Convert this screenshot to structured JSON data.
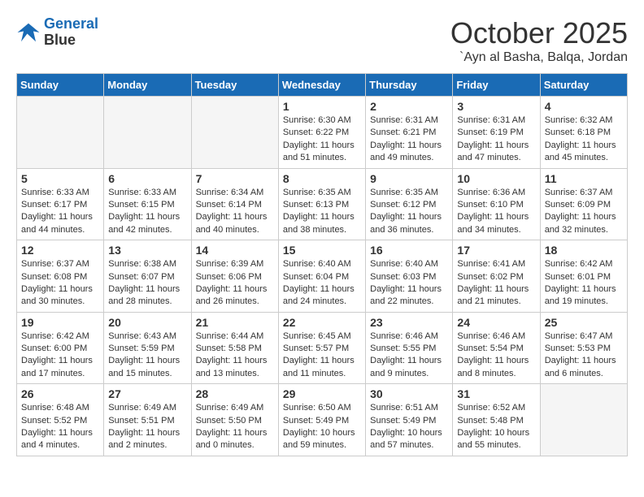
{
  "header": {
    "logo_line1": "General",
    "logo_line2": "Blue",
    "month": "October 2025",
    "location": "`Ayn al Basha, Balqa, Jordan"
  },
  "weekdays": [
    "Sunday",
    "Monday",
    "Tuesday",
    "Wednesday",
    "Thursday",
    "Friday",
    "Saturday"
  ],
  "weeks": [
    [
      {
        "day": "",
        "info": ""
      },
      {
        "day": "",
        "info": ""
      },
      {
        "day": "",
        "info": ""
      },
      {
        "day": "1",
        "info": "Sunrise: 6:30 AM\nSunset: 6:22 PM\nDaylight: 11 hours\nand 51 minutes."
      },
      {
        "day": "2",
        "info": "Sunrise: 6:31 AM\nSunset: 6:21 PM\nDaylight: 11 hours\nand 49 minutes."
      },
      {
        "day": "3",
        "info": "Sunrise: 6:31 AM\nSunset: 6:19 PM\nDaylight: 11 hours\nand 47 minutes."
      },
      {
        "day": "4",
        "info": "Sunrise: 6:32 AM\nSunset: 6:18 PM\nDaylight: 11 hours\nand 45 minutes."
      }
    ],
    [
      {
        "day": "5",
        "info": "Sunrise: 6:33 AM\nSunset: 6:17 PM\nDaylight: 11 hours\nand 44 minutes."
      },
      {
        "day": "6",
        "info": "Sunrise: 6:33 AM\nSunset: 6:15 PM\nDaylight: 11 hours\nand 42 minutes."
      },
      {
        "day": "7",
        "info": "Sunrise: 6:34 AM\nSunset: 6:14 PM\nDaylight: 11 hours\nand 40 minutes."
      },
      {
        "day": "8",
        "info": "Sunrise: 6:35 AM\nSunset: 6:13 PM\nDaylight: 11 hours\nand 38 minutes."
      },
      {
        "day": "9",
        "info": "Sunrise: 6:35 AM\nSunset: 6:12 PM\nDaylight: 11 hours\nand 36 minutes."
      },
      {
        "day": "10",
        "info": "Sunrise: 6:36 AM\nSunset: 6:10 PM\nDaylight: 11 hours\nand 34 minutes."
      },
      {
        "day": "11",
        "info": "Sunrise: 6:37 AM\nSunset: 6:09 PM\nDaylight: 11 hours\nand 32 minutes."
      }
    ],
    [
      {
        "day": "12",
        "info": "Sunrise: 6:37 AM\nSunset: 6:08 PM\nDaylight: 11 hours\nand 30 minutes."
      },
      {
        "day": "13",
        "info": "Sunrise: 6:38 AM\nSunset: 6:07 PM\nDaylight: 11 hours\nand 28 minutes."
      },
      {
        "day": "14",
        "info": "Sunrise: 6:39 AM\nSunset: 6:06 PM\nDaylight: 11 hours\nand 26 minutes."
      },
      {
        "day": "15",
        "info": "Sunrise: 6:40 AM\nSunset: 6:04 PM\nDaylight: 11 hours\nand 24 minutes."
      },
      {
        "day": "16",
        "info": "Sunrise: 6:40 AM\nSunset: 6:03 PM\nDaylight: 11 hours\nand 22 minutes."
      },
      {
        "day": "17",
        "info": "Sunrise: 6:41 AM\nSunset: 6:02 PM\nDaylight: 11 hours\nand 21 minutes."
      },
      {
        "day": "18",
        "info": "Sunrise: 6:42 AM\nSunset: 6:01 PM\nDaylight: 11 hours\nand 19 minutes."
      }
    ],
    [
      {
        "day": "19",
        "info": "Sunrise: 6:42 AM\nSunset: 6:00 PM\nDaylight: 11 hours\nand 17 minutes."
      },
      {
        "day": "20",
        "info": "Sunrise: 6:43 AM\nSunset: 5:59 PM\nDaylight: 11 hours\nand 15 minutes."
      },
      {
        "day": "21",
        "info": "Sunrise: 6:44 AM\nSunset: 5:58 PM\nDaylight: 11 hours\nand 13 minutes."
      },
      {
        "day": "22",
        "info": "Sunrise: 6:45 AM\nSunset: 5:57 PM\nDaylight: 11 hours\nand 11 minutes."
      },
      {
        "day": "23",
        "info": "Sunrise: 6:46 AM\nSunset: 5:55 PM\nDaylight: 11 hours\nand 9 minutes."
      },
      {
        "day": "24",
        "info": "Sunrise: 6:46 AM\nSunset: 5:54 PM\nDaylight: 11 hours\nand 8 minutes."
      },
      {
        "day": "25",
        "info": "Sunrise: 6:47 AM\nSunset: 5:53 PM\nDaylight: 11 hours\nand 6 minutes."
      }
    ],
    [
      {
        "day": "26",
        "info": "Sunrise: 6:48 AM\nSunset: 5:52 PM\nDaylight: 11 hours\nand 4 minutes."
      },
      {
        "day": "27",
        "info": "Sunrise: 6:49 AM\nSunset: 5:51 PM\nDaylight: 11 hours\nand 2 minutes."
      },
      {
        "day": "28",
        "info": "Sunrise: 6:49 AM\nSunset: 5:50 PM\nDaylight: 11 hours\nand 0 minutes."
      },
      {
        "day": "29",
        "info": "Sunrise: 6:50 AM\nSunset: 5:49 PM\nDaylight: 10 hours\nand 59 minutes."
      },
      {
        "day": "30",
        "info": "Sunrise: 6:51 AM\nSunset: 5:49 PM\nDaylight: 10 hours\nand 57 minutes."
      },
      {
        "day": "31",
        "info": "Sunrise: 6:52 AM\nSunset: 5:48 PM\nDaylight: 10 hours\nand 55 minutes."
      },
      {
        "day": "",
        "info": ""
      }
    ]
  ]
}
